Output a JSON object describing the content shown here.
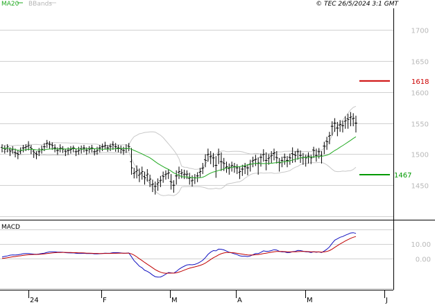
{
  "header": {
    "ma_label": "MA20",
    "bb_label": "BBands",
    "copyright": "© TEC 26/5/2024 3:1 GMT"
  },
  "colors": {
    "price": "#000000",
    "ma": "#22aa22",
    "bands": "#c8c8c8",
    "resistance": "#cc0000",
    "support": "#009900",
    "macd": "#1010c0",
    "signal": "#c00000",
    "grid": "#d0d0d0",
    "tick_label": "#b8b8b8"
  },
  "chart_data": [
    {
      "type": "ohlc",
      "title": "",
      "yticks": [
        1450,
        1500,
        1550,
        1600,
        1650,
        1700
      ],
      "ylim": [
        1400,
        1735
      ],
      "xlabels": [
        "24",
        "F",
        "M",
        "A",
        "M",
        "J"
      ],
      "levels": [
        {
          "name": "resistance",
          "label": "1618",
          "value": 1618
        },
        {
          "name": "support",
          "label": "1467",
          "value": 1467
        }
      ],
      "close": [
        1510,
        1508,
        1512,
        1505,
        1508,
        1502,
        1500,
        1506,
        1510,
        1512,
        1514,
        1509,
        1503,
        1500,
        1504,
        1508,
        1512,
        1518,
        1516,
        1514,
        1510,
        1506,
        1510,
        1508,
        1504,
        1506,
        1508,
        1510,
        1504,
        1506,
        1508,
        1510,
        1506,
        1508,
        1510,
        1504,
        1506,
        1510,
        1512,
        1514,
        1510,
        1512,
        1515,
        1512,
        1510,
        1508,
        1506,
        1509,
        1512,
        1478,
        1470,
        1474,
        1468,
        1472,
        1462,
        1468,
        1460,
        1452,
        1448,
        1454,
        1458,
        1464,
        1468,
        1470,
        1455,
        1450,
        1465,
        1472,
        1470,
        1468,
        1468,
        1462,
        1458,
        1462,
        1465,
        1472,
        1478,
        1490,
        1500,
        1497,
        1494,
        1482,
        1500,
        1488,
        1485,
        1480,
        1478,
        1482,
        1480,
        1478,
        1472,
        1476,
        1480,
        1478,
        1484,
        1490,
        1492,
        1486,
        1495,
        1500,
        1490,
        1494,
        1498,
        1502,
        1494,
        1486,
        1490,
        1495,
        1490,
        1494,
        1500,
        1498,
        1504,
        1498,
        1495,
        1494,
        1497,
        1494,
        1506,
        1498,
        1504,
        1497,
        1513,
        1520,
        1530,
        1545,
        1550,
        1542,
        1548,
        1546,
        1554,
        1556,
        1560,
        1558,
        1550
      ],
      "high": [
        1516,
        1514,
        1516,
        1511,
        1513,
        1509,
        1507,
        1511,
        1515,
        1516,
        1521,
        1515,
        1508,
        1505,
        1510,
        1514,
        1518,
        1523,
        1521,
        1519,
        1516,
        1511,
        1516,
        1513,
        1509,
        1511,
        1513,
        1514,
        1509,
        1512,
        1514,
        1515,
        1511,
        1513,
        1515,
        1509,
        1512,
        1515,
        1517,
        1520,
        1515,
        1517,
        1521,
        1518,
        1515,
        1514,
        1512,
        1516,
        1518,
        1510,
        1478,
        1482,
        1477,
        1480,
        1472,
        1476,
        1467,
        1459,
        1456,
        1461,
        1465,
        1472,
        1474,
        1476,
        1468,
        1458,
        1474,
        1480,
        1476,
        1475,
        1474,
        1470,
        1466,
        1468,
        1471,
        1478,
        1486,
        1500,
        1509,
        1505,
        1502,
        1497,
        1509,
        1503,
        1494,
        1488,
        1485,
        1488,
        1486,
        1484,
        1480,
        1483,
        1486,
        1484,
        1491,
        1496,
        1499,
        1495,
        1501,
        1508,
        1503,
        1500,
        1505,
        1509,
        1505,
        1494,
        1496,
        1501,
        1497,
        1501,
        1511,
        1505,
        1509,
        1506,
        1502,
        1499,
        1503,
        1499,
        1512,
        1509,
        1510,
        1505,
        1520,
        1528,
        1536,
        1553,
        1558,
        1552,
        1555,
        1554,
        1561,
        1565,
        1568,
        1566,
        1562
      ],
      "low": [
        1503,
        1501,
        1503,
        1497,
        1501,
        1495,
        1492,
        1500,
        1503,
        1505,
        1506,
        1500,
        1494,
        1492,
        1497,
        1501,
        1505,
        1510,
        1509,
        1507,
        1503,
        1499,
        1503,
        1502,
        1497,
        1499,
        1501,
        1503,
        1497,
        1499,
        1501,
        1503,
        1499,
        1502,
        1503,
        1498,
        1499,
        1503,
        1505,
        1508,
        1504,
        1505,
        1507,
        1504,
        1503,
        1501,
        1499,
        1502,
        1505,
        1467,
        1461,
        1461,
        1455,
        1459,
        1451,
        1456,
        1447,
        1439,
        1435,
        1441,
        1447,
        1454,
        1459,
        1460,
        1443,
        1438,
        1451,
        1460,
        1461,
        1460,
        1460,
        1451,
        1448,
        1452,
        1455,
        1463,
        1468,
        1479,
        1488,
        1484,
        1479,
        1462,
        1484,
        1473,
        1473,
        1470,
        1467,
        1472,
        1470,
        1468,
        1460,
        1465,
        1468,
        1466,
        1472,
        1479,
        1481,
        1467,
        1480,
        1488,
        1474,
        1483,
        1486,
        1490,
        1485,
        1472,
        1479,
        1483,
        1479,
        1483,
        1486,
        1487,
        1491,
        1486,
        1483,
        1480,
        1485,
        1484,
        1494,
        1488,
        1493,
        1485,
        1500,
        1507,
        1516,
        1530,
        1536,
        1529,
        1536,
        1535,
        1541,
        1541,
        1545,
        1545,
        1535
      ],
      "open": [
        1511,
        1509,
        1510,
        1507,
        1507,
        1503,
        1501,
        1504,
        1510,
        1511,
        1513,
        1511,
        1505,
        1501,
        1504,
        1507,
        1512,
        1517,
        1516,
        1515,
        1510,
        1506,
        1509,
        1509,
        1505,
        1506,
        1507,
        1510,
        1504,
        1505,
        1509,
        1510,
        1506,
        1509,
        1510,
        1504,
        1505,
        1510,
        1512,
        1513,
        1510,
        1513,
        1516,
        1512,
        1510,
        1509,
        1506,
        1509,
        1513,
        1488,
        1469,
        1472,
        1466,
        1470,
        1464,
        1466,
        1458,
        1451,
        1448,
        1452,
        1457,
        1465,
        1467,
        1469,
        1456,
        1450,
        1465,
        1471,
        1469,
        1467,
        1467,
        1461,
        1457,
        1462,
        1465,
        1471,
        1477,
        1491,
        1499,
        1496,
        1494,
        1482,
        1499,
        1488,
        1486,
        1479,
        1477,
        1481,
        1480,
        1478,
        1471,
        1476,
        1480,
        1478,
        1484,
        1489,
        1491,
        1485,
        1495,
        1499,
        1490,
        1493,
        1497,
        1501,
        1495,
        1487,
        1490,
        1495,
        1490,
        1495,
        1501,
        1499,
        1504,
        1498,
        1494,
        1495,
        1497,
        1495,
        1507,
        1498,
        1504,
        1498,
        1513,
        1521,
        1529,
        1545,
        1550,
        1542,
        1547,
        1546,
        1553,
        1557,
        1559,
        1557,
        1550
      ]
    },
    {
      "type": "line",
      "title": "MACD",
      "yticks": [
        "0.00",
        "10.00"
      ],
      "series": [
        {
          "values": [
            1.2,
            1.6,
            1.9,
            2.4,
            2.6,
            2.5,
            2.7,
            3.0,
            3.4,
            3.5,
            3.5,
            3.3,
            3.1,
            3.0,
            3.2,
            3.5,
            3.8,
            4.3,
            4.6,
            4.7,
            4.7,
            4.5,
            4.5,
            4.4,
            4.1,
            4.0,
            3.9,
            4.0,
            3.7,
            3.6,
            3.6,
            3.7,
            3.5,
            3.5,
            3.6,
            3.3,
            3.3,
            3.4,
            3.6,
            3.8,
            3.7,
            3.8,
            4.1,
            4.1,
            4.1,
            3.9,
            3.7,
            3.8,
            3.9,
            1.4,
            -1.3,
            -3.1,
            -5.0,
            -6.1,
            -7.8,
            -8.5,
            -9.6,
            -11.0,
            -12.1,
            -12.4,
            -12.3,
            -11.5,
            -10.4,
            -9.3,
            -9.5,
            -9.7,
            -8.6,
            -7.1,
            -5.9,
            -5.0,
            -4.2,
            -4.0,
            -4.1,
            -3.8,
            -3.2,
            -2.2,
            -1.0,
            0.8,
            3.0,
            4.5,
            5.5,
            5.3,
            6.5,
            6.4,
            6.0,
            5.2,
            4.4,
            3.9,
            3.3,
            2.8,
            2.0,
            1.7,
            1.7,
            1.5,
            1.9,
            2.7,
            3.5,
            3.5,
            4.3,
            5.3,
            5.0,
            5.1,
            5.5,
            6.1,
            5.9,
            5.0,
            4.6,
            4.6,
            4.1,
            4.2,
            4.8,
            5.0,
            5.6,
            5.5,
            5.1,
            4.7,
            4.6,
            4.2,
            4.7,
            4.4,
            4.6,
            4.2,
            5.2,
            6.4,
            8.0,
            10.4,
            12.6,
            13.5,
            14.5,
            15.0,
            15.9,
            16.6,
            17.4,
            17.6,
            17.1
          ],
          "color": "#1010c0"
        },
        {
          "values": [
            0.2,
            0.4,
            0.7,
            1.0,
            1.3,
            1.5,
            1.8,
            2.0,
            2.3,
            2.5,
            2.7,
            2.8,
            2.9,
            2.9,
            3.0,
            3.1,
            3.3,
            3.5,
            3.7,
            3.9,
            4.1,
            4.2,
            4.2,
            4.3,
            4.3,
            4.2,
            4.2,
            4.1,
            4.1,
            4.0,
            4.0,
            3.9,
            3.8,
            3.8,
            3.7,
            3.6,
            3.6,
            3.5,
            3.5,
            3.6,
            3.6,
            3.6,
            3.7,
            3.7,
            3.8,
            3.8,
            3.8,
            3.8,
            3.8,
            3.3,
            2.4,
            1.3,
            0.0,
            -1.2,
            -2.5,
            -3.7,
            -4.9,
            -6.1,
            -7.3,
            -8.3,
            -9.1,
            -9.6,
            -9.8,
            -9.7,
            -9.7,
            -9.7,
            -9.5,
            -9.0,
            -8.4,
            -7.7,
            -7.0,
            -6.4,
            -5.9,
            -5.5,
            -5.0,
            -4.5,
            -3.8,
            -2.9,
            -1.7,
            -0.5,
            0.7,
            1.6,
            2.6,
            3.4,
            3.9,
            4.2,
            4.2,
            4.1,
            4.0,
            3.7,
            3.4,
            3.1,
            2.8,
            2.6,
            2.5,
            2.5,
            2.7,
            2.8,
            3.1,
            3.5,
            3.8,
            4.1,
            4.4,
            4.7,
            4.9,
            4.9,
            4.9,
            4.8,
            4.7,
            4.6,
            4.7,
            4.7,
            4.8,
            4.9,
            4.9,
            4.9,
            4.8,
            4.7,
            4.7,
            4.6,
            4.6,
            4.5,
            4.6,
            4.9,
            5.5,
            6.5,
            7.7,
            8.9,
            10.0,
            11.0,
            12.0,
            12.9,
            13.8,
            14.5,
            15.0
          ],
          "color": "#c00000"
        }
      ]
    }
  ]
}
